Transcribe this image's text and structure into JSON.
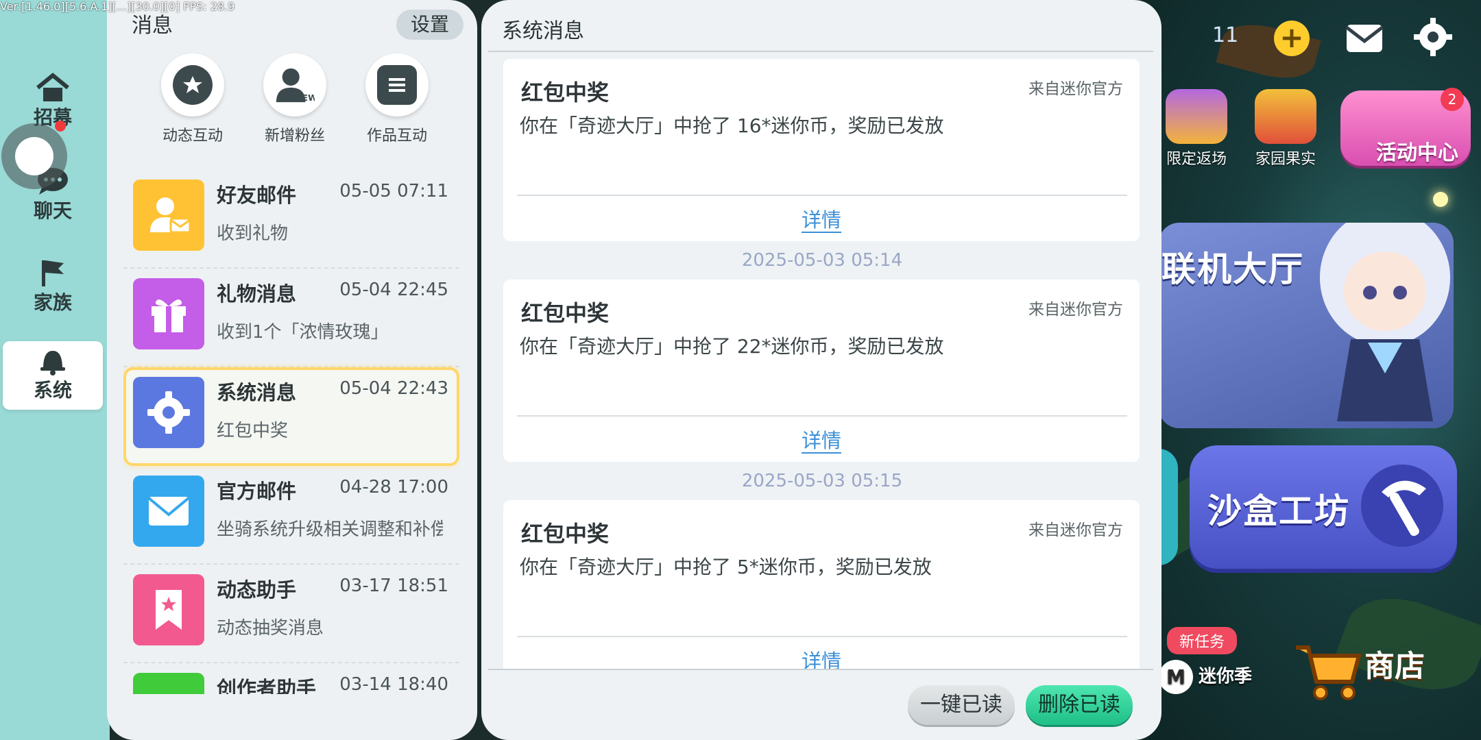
{
  "version_overlay": "Ver:[1.46.0][5.6.A.1][...][30.0][0] FPS: 28.9",
  "left_nav": {
    "items": [
      {
        "label": "招募",
        "icon": "house-icon"
      },
      {
        "label": "聊天",
        "icon": "chat-icon"
      },
      {
        "label": "家族",
        "icon": "flag-icon"
      },
      {
        "label": "系统",
        "icon": "bell-icon"
      }
    ],
    "active_index": 3
  },
  "messages": {
    "title": "消息",
    "settings_label": "设置",
    "quick_actions": [
      {
        "label": "动态互动",
        "icon": "star-bubble-icon"
      },
      {
        "label": "新增粉丝",
        "icon": "new-fan-icon"
      },
      {
        "label": "作品互动",
        "icon": "list-icon"
      }
    ],
    "conversations": [
      {
        "name": "好友邮件",
        "time": "05-05 07:11",
        "preview": "收到礼物",
        "icon": "friend-mail-icon",
        "color": "#ffc234"
      },
      {
        "name": "礼物消息",
        "time": "05-04 22:45",
        "preview": "收到1个「浓情玫瑰」",
        "icon": "gift-icon",
        "color": "#c45de8"
      },
      {
        "name": "系统消息",
        "time": "05-04 22:43",
        "preview": "红包中奖",
        "icon": "gear-icon",
        "color": "#5b78e0"
      },
      {
        "name": "官方邮件",
        "time": "04-28 17:00",
        "preview": "坐骑系统升级相关调整和补偿",
        "icon": "envelope-icon",
        "color": "#34a8ee"
      },
      {
        "name": "动态助手",
        "time": "03-17 18:51",
        "preview": "动态抽奖消息",
        "icon": "bookmark-star-icon",
        "color": "#f25a8f"
      },
      {
        "name": "创作者助手",
        "time": "03-14 18:40",
        "preview": "",
        "icon": "creator-icon",
        "color": "#3fcb3a"
      }
    ],
    "active_index": 2
  },
  "system_messages": {
    "title": "系统消息",
    "cards": [
      {
        "date": "",
        "title": "红包中奖",
        "source": "来自迷你官方",
        "body": "你在「奇迹大厅」中抢了 16*迷你币，奖励已发放",
        "detail": "详情"
      },
      {
        "date": "2025-05-03 05:14",
        "title": "红包中奖",
        "source": "来自迷你官方",
        "body": "你在「奇迹大厅」中抢了 22*迷你币，奖励已发放",
        "detail": "详情"
      },
      {
        "date": "2025-05-03 05:15",
        "title": "红包中奖",
        "source": "来自迷你官方",
        "body": "你在「奇迹大厅」中抢了 5*迷你币，奖励已发放",
        "detail": "详情"
      }
    ],
    "mark_read_label": "一键已读",
    "delete_read_label": "删除已读"
  },
  "game_hud": {
    "currency_count": "11",
    "events": [
      {
        "label": "限定返场"
      },
      {
        "label": "家园果实"
      }
    ],
    "activity_center": {
      "label": "活动中心",
      "badge": "2"
    },
    "lobby_label": "联机大厅",
    "sandbox_label": "沙盒工坊",
    "new_task_label": "新任务",
    "season_label": "迷你季",
    "shop_label": "商店"
  }
}
